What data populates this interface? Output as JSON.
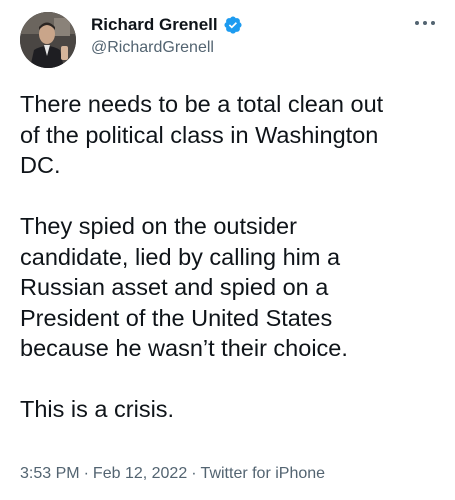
{
  "author": {
    "name": "Richard Grenell",
    "handle": "@RichardGrenell",
    "verified_icon": "verified-badge-icon",
    "verified_color": "#1d9bf0"
  },
  "menu": {
    "icon": "more-horizontal-icon"
  },
  "tweet": {
    "paragraphs": [
      "There needs to be a total clean out\nof the political class in Washington\nDC.",
      "They spied on the outsider\ncandidate, lied by calling him a\nRussian asset and spied on a\nPresident of the United States\nbecause he wasn’t their choice.",
      "This is a crisis."
    ]
  },
  "meta": {
    "time": "3:53 PM",
    "separator": "·",
    "date": "Feb 12, 2022",
    "source": "Twitter for iPhone"
  }
}
